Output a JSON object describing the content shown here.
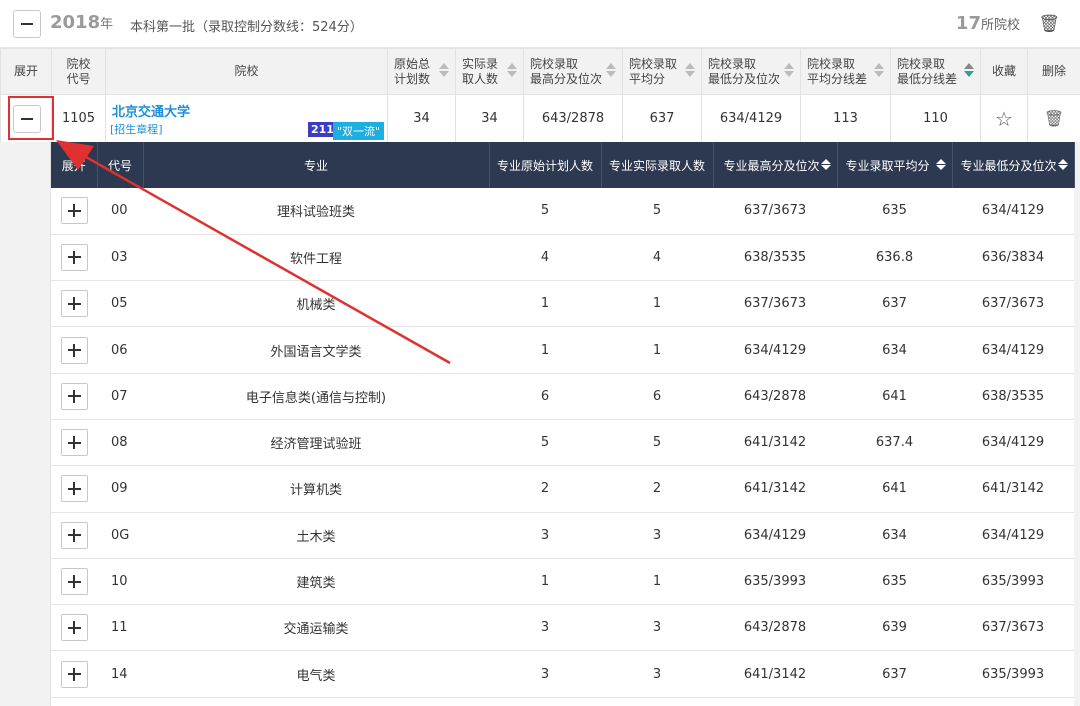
{
  "topbar": {
    "year": "2018",
    "year_unit": "年",
    "batch_text": "本科第一批（录取控制分数线：524分）",
    "school_count": "17",
    "school_count_unit": "所院校"
  },
  "school_table": {
    "headers": {
      "expand": "展开",
      "code": "院校\n代号",
      "school": "院校",
      "plan": "原始总\n计划数",
      "actual": "实际录\n取人数",
      "max": "院校录取\n最高分及位次",
      "avg": "院校录取\n平均分",
      "min": "院校录取\n最低分及位次",
      "avg_diff": "院校录取\n平均分线差",
      "min_diff": "院校录取\n最低分线差",
      "favorite": "收藏",
      "delete": "删除"
    },
    "row": {
      "code": "1105",
      "name": "北京交通大学",
      "link": "[招生章程]",
      "tag_211": "211",
      "tag_double": "\"双一流\"",
      "plan": "34",
      "actual": "34",
      "max": "643/2878",
      "avg": "637",
      "min": "634/4129",
      "avg_diff": "113",
      "min_diff": "110"
    }
  },
  "major_table": {
    "headers": {
      "expand": "展开",
      "code": "代号",
      "major": "专业",
      "plan": "专业原始计划人数",
      "actual": "专业实际录取人数",
      "max": "专业最高分及位次",
      "avg": "专业录取平均分",
      "min": "专业最低分及位次"
    },
    "rows": [
      {
        "code": "00",
        "major": "理科试验班类",
        "plan": "5",
        "actual": "5",
        "max": "637/3673",
        "avg": "635",
        "min": "634/4129"
      },
      {
        "code": "03",
        "major": "软件工程",
        "plan": "4",
        "actual": "4",
        "max": "638/3535",
        "avg": "636.8",
        "min": "636/3834"
      },
      {
        "code": "05",
        "major": "机械类",
        "plan": "1",
        "actual": "1",
        "max": "637/3673",
        "avg": "637",
        "min": "637/3673"
      },
      {
        "code": "06",
        "major": "外国语言文学类",
        "plan": "1",
        "actual": "1",
        "max": "634/4129",
        "avg": "634",
        "min": "634/4129"
      },
      {
        "code": "07",
        "major": "电子信息类(通信与控制)",
        "plan": "6",
        "actual": "6",
        "max": "643/2878",
        "avg": "641",
        "min": "638/3535"
      },
      {
        "code": "08",
        "major": "经济管理试验班",
        "plan": "5",
        "actual": "5",
        "max": "641/3142",
        "avg": "637.4",
        "min": "634/4129"
      },
      {
        "code": "09",
        "major": "计算机类",
        "plan": "2",
        "actual": "2",
        "max": "641/3142",
        "avg": "641",
        "min": "641/3142"
      },
      {
        "code": "0G",
        "major": "土木类",
        "plan": "3",
        "actual": "3",
        "max": "634/4129",
        "avg": "634",
        "min": "634/4129"
      },
      {
        "code": "10",
        "major": "建筑类",
        "plan": "1",
        "actual": "1",
        "max": "635/3993",
        "avg": "635",
        "min": "635/3993"
      },
      {
        "code": "11",
        "major": "交通运输类",
        "plan": "3",
        "actual": "3",
        "max": "643/2878",
        "avg": "639",
        "min": "637/3673"
      },
      {
        "code": "14",
        "major": "电气类",
        "plan": "3",
        "actual": "3",
        "max": "641/3142",
        "avg": "637",
        "min": "635/3993"
      }
    ]
  },
  "icons": {
    "collapse": "minus-icon",
    "expand": "plus-icon",
    "favorite": "star-icon",
    "delete": "trash-icon",
    "annotation": "red-arrow"
  },
  "colors": {
    "link_blue": "#1e8fd8",
    "header_dark": "#2d3950",
    "tag_211": "#3b3ec2",
    "tag_double": "#1eaee0",
    "annotation_red": "#e03030"
  }
}
